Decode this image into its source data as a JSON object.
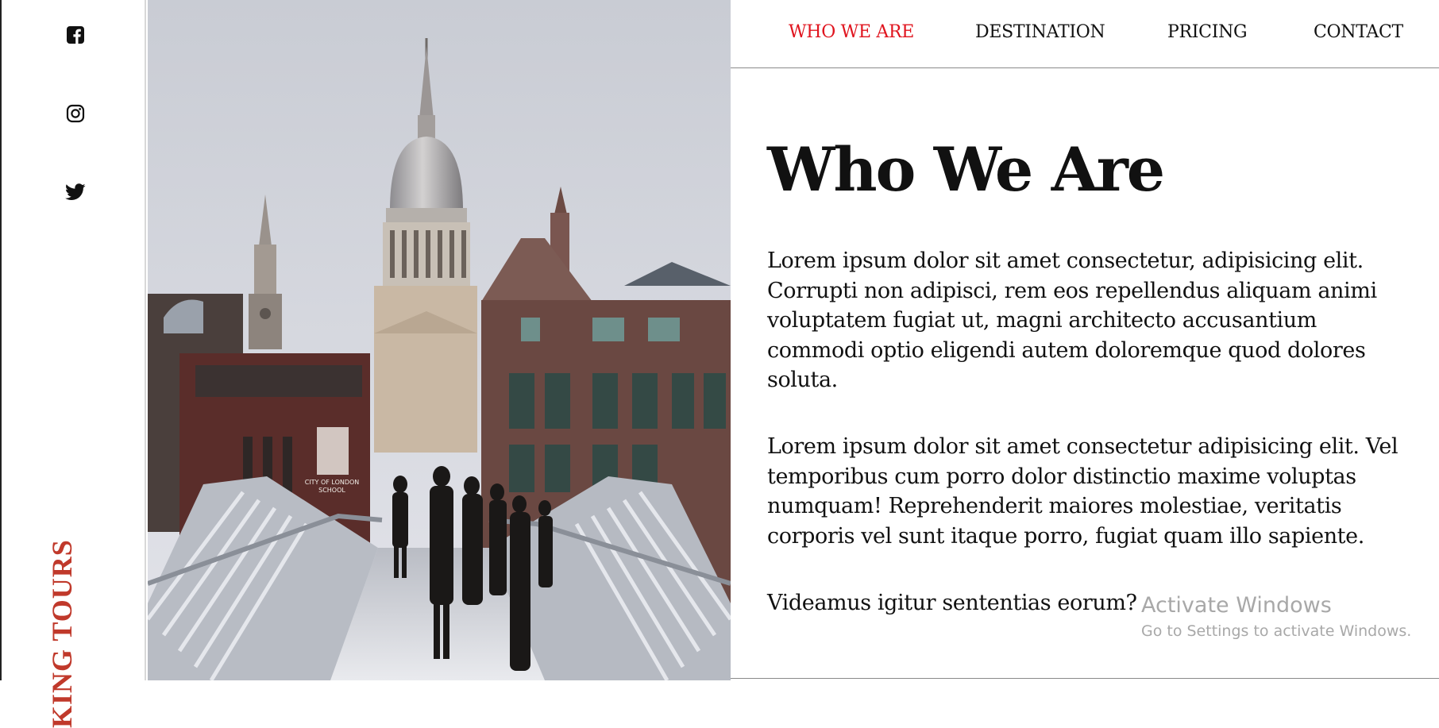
{
  "sidebar": {
    "social": [
      {
        "icon": "facebook-icon"
      },
      {
        "icon": "instagram-icon"
      },
      {
        "icon": "twitter-icon"
      }
    ],
    "brand": "KING TOURS",
    "brand_color": "#c0392b"
  },
  "nav": {
    "items": [
      "WHO WE ARE",
      "DESTINATION",
      "PRICING",
      "CONTACT"
    ],
    "active_index": 0,
    "active_color": "#e0141e"
  },
  "main": {
    "title": "Who We Are",
    "paragraphs": [
      "Lorem ipsum dolor sit amet consectetur, adipisicing elit. Corrupti non adipisci, rem eos repellendus aliquam animi voluptatem fugiat ut, magni architecto accusantium commodi optio eligendi autem doloremque quod dolores soluta.",
      "Lorem ipsum dolor sit amet consectetur adipisicing elit. Vel temporibus cum porro dolor distinctio maxime voluptas numquam! Reprehenderit maiores molestiae, veritatis corporis vel sunt itaque porro, fugiat quam illo sapiente.",
      "Videamus igitur sententias eorum?"
    ]
  },
  "hero_image": {
    "sign_line1": "CITY OF LONDON",
    "sign_line2": "SCHOOL"
  },
  "watermark": {
    "title": "Activate Windows",
    "subtitle": "Go to Settings to activate Windows."
  }
}
